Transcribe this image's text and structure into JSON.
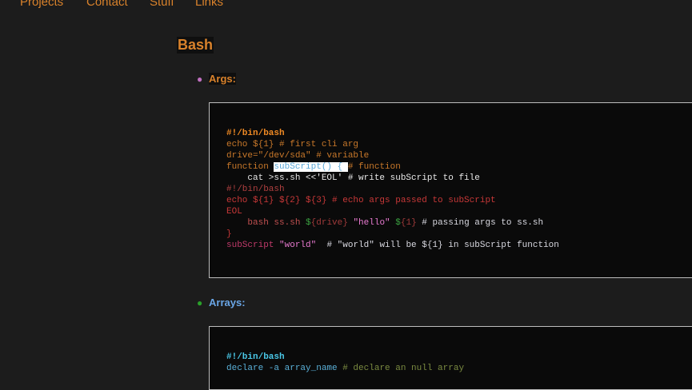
{
  "nav": {
    "items": [
      {
        "label": "Projects"
      },
      {
        "label": "Contact"
      },
      {
        "label": "Stuff"
      },
      {
        "label": "Links"
      }
    ]
  },
  "page": {
    "title": "Bash"
  },
  "colors": {
    "accent": "#d9822b",
    "background": "#1c1c1c",
    "code_background": "#0a0a0a",
    "bullet_args": "#c070c0",
    "bullet_arrays": "#2aa02a",
    "heading_arrays": "#6aa6e6"
  },
  "sections": [
    {
      "heading": "Args:",
      "code": [
        [
          {
            "t": "#!/bin/bash",
            "c": "#f08a24",
            "b": true
          }
        ],
        [
          {
            "t": "echo ${1} # first cli arg",
            "c": "#c8782a"
          }
        ],
        [
          {
            "t": "drive=\"/dev/sda\" # variable",
            "c": "#c8782a"
          }
        ],
        [
          {
            "t": "function ",
            "c": "#c8782a"
          },
          {
            "t": "subScript() { ",
            "hl": true
          },
          {
            "t": "# function",
            "c": "#c8782a"
          }
        ],
        [
          {
            "t": "    cat >ss.sh <<'EOL' # write subScript to file",
            "c": "#e8e8e8"
          }
        ],
        [
          {
            "t": "#!/bin/bash",
            "c": "#b04040"
          }
        ],
        [
          {
            "t": "echo ${1} ${2} ${3} # echo args passed to subScript",
            "c": "#c83838"
          }
        ],
        [
          {
            "t": "EOL",
            "c": "#c83838"
          }
        ],
        [
          {
            "t": "    bash ss.sh ",
            "c": "#c05050"
          },
          {
            "t": "$",
            "c": "#3aa040"
          },
          {
            "t": "{drive} ",
            "c": "#a03a3a"
          },
          {
            "t": "\"hello\" ",
            "c": "#e87ad0"
          },
          {
            "t": "$",
            "c": "#3aa040"
          },
          {
            "t": "{1} ",
            "c": "#a03a3a"
          },
          {
            "t": "# passing args to ss.sh",
            "c": "#d8d8e0"
          }
        ],
        [
          {
            "t": "}",
            "c": "#c83838"
          }
        ],
        [
          {
            "t": "subScript ",
            "c": "#c03a6a"
          },
          {
            "t": "\"world\"  ",
            "c": "#e87ad0"
          },
          {
            "t": "# \"world\" will be ${1} in subScript function",
            "c": "#d8d8e0"
          }
        ]
      ]
    },
    {
      "heading": "Arrays:",
      "code": [
        [
          {
            "t": "#!/bin/bash",
            "c": "#4ac8e8",
            "b": true
          }
        ],
        [
          {
            "t": "declare -a array_name ",
            "c": "#5ab0d8"
          },
          {
            "t": "# declare an null array",
            "c": "#7a8a40"
          }
        ]
      ]
    }
  ]
}
